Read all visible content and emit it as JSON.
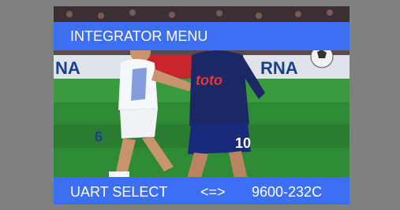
{
  "osd": {
    "menu_title": "INTEGRATOR MENU",
    "setting_name": "UART SELECT",
    "setting_arrows": "<=>",
    "setting_value": "9600-232C"
  },
  "background_image": {
    "description": "football match video frame",
    "banner_text_1": "NA",
    "banner_text_2": "toto",
    "banner_text_3": "RNA",
    "shirt_number_left": "6",
    "shirt_number_right": "10"
  },
  "colors": {
    "osd_bar": "#3d6ff5",
    "osd_text": "#ffffff",
    "outer_border": "#808080",
    "pitch": "#2f8a35"
  }
}
